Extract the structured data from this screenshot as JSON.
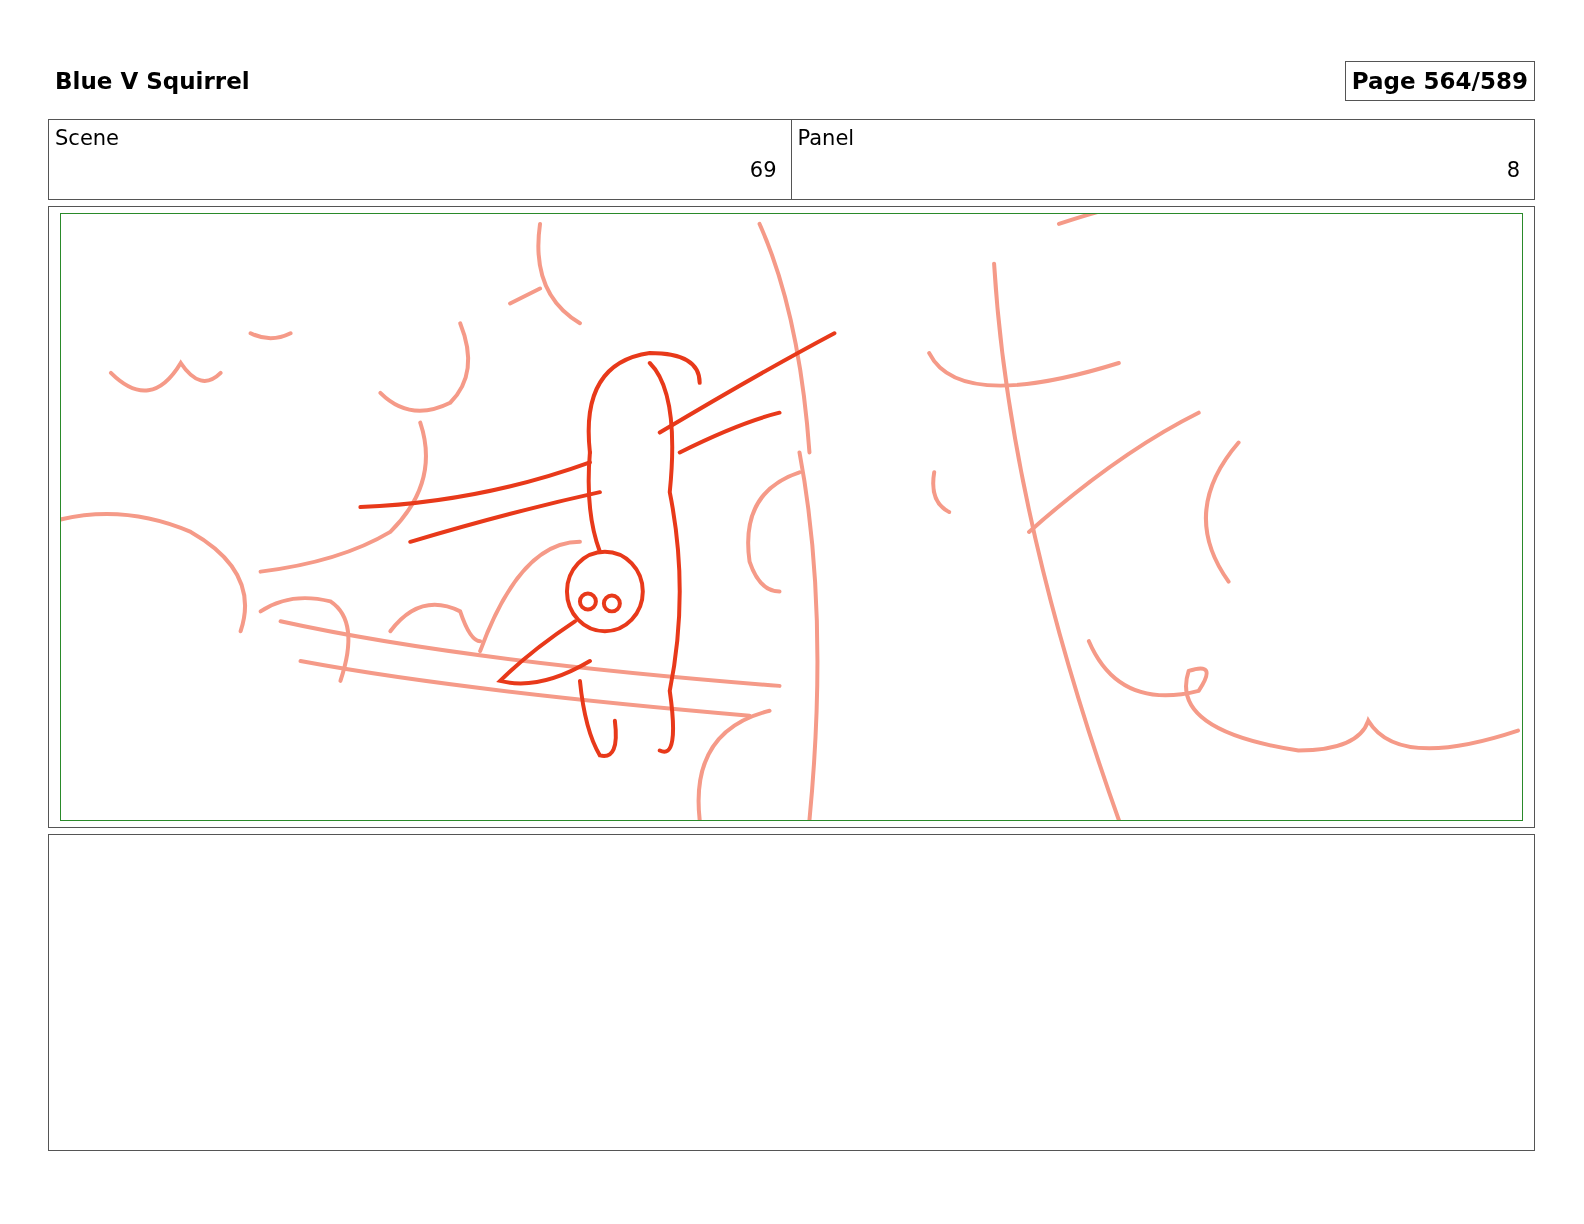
{
  "title": "Blue V Squirrel",
  "page": "Page 564/589",
  "fields": [
    {
      "label": "Scene",
      "value": "69"
    },
    {
      "label": "Panel",
      "value": "8"
    }
  ]
}
